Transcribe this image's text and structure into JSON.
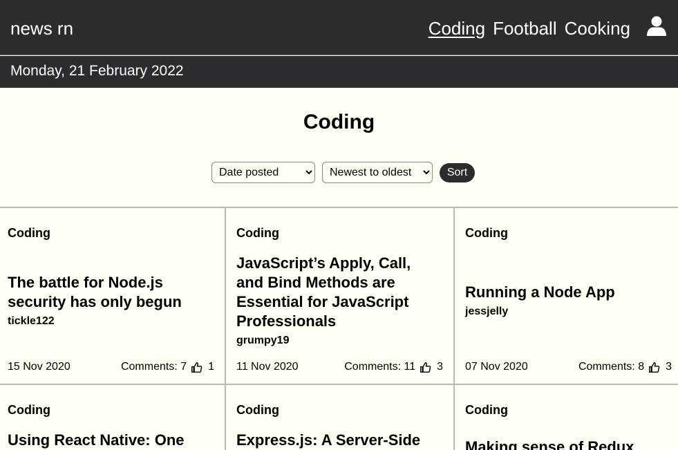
{
  "header": {
    "brand": "news rn",
    "nav": [
      {
        "label": "Coding",
        "active": true
      },
      {
        "label": "Football",
        "active": false
      },
      {
        "label": "Cooking",
        "active": false
      }
    ],
    "user_icon": "user-icon"
  },
  "datebar": {
    "date": "Monday, 21 February 2022"
  },
  "main": {
    "title": "Coding",
    "sort": {
      "field_selected": "Date posted",
      "order_selected": "Newest to oldest",
      "button_label": "Sort"
    },
    "articles": [
      {
        "topic": "Coding",
        "title": "The battle for Node.js security has only begun",
        "author": "tickle122",
        "date": "15 Nov 2020",
        "comments": "Comments: 7",
        "votes": "1"
      },
      {
        "topic": "Coding",
        "title": "JavaScript’s Apply, Call, and Bind Methods are Essential for JavaScript Professionals",
        "author": "grumpy19",
        "date": "11 Nov 2020",
        "comments": "Comments: 11",
        "votes": "3"
      },
      {
        "topic": "Coding",
        "title": "Running a Node App",
        "author": "jessjelly",
        "date": "07 Nov 2020",
        "comments": "Comments: 8",
        "votes": "3"
      },
      {
        "topic": "Coding",
        "title": "Using React Native: One",
        "author": "",
        "date": "",
        "comments": "",
        "votes": ""
      },
      {
        "topic": "Coding",
        "title": "Express.js: A Server-Side",
        "author": "",
        "date": "",
        "comments": "",
        "votes": ""
      },
      {
        "topic": "Coding",
        "title": "Making sense of Redux",
        "author": "",
        "date": "",
        "comments": "",
        "votes": ""
      }
    ]
  },
  "colors": {
    "bar": "#2a2c2e",
    "page_bg": "#fffef3",
    "divider": "#b9b9b3"
  }
}
